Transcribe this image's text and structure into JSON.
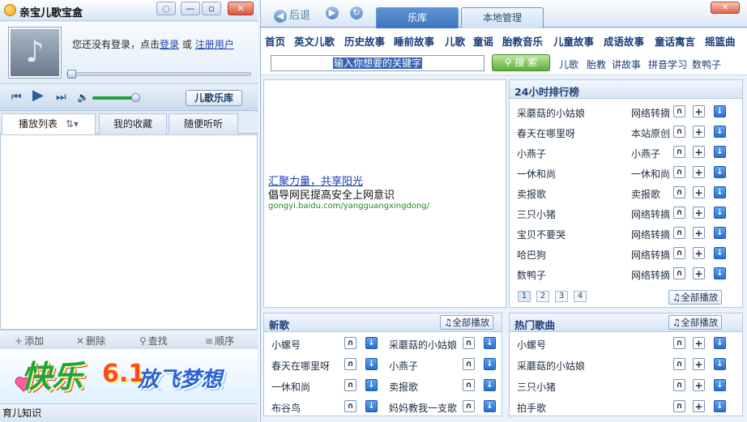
{
  "left": {
    "title": "亲宝儿歌宝盒",
    "login": {
      "prefix": "您还没有登录，点击",
      "login_link": "登录",
      "middle": "或",
      "register_link": "注册用户"
    },
    "songlib_button": "儿歌乐库",
    "tabs": [
      "播放列表",
      "我的收藏",
      "随便听听"
    ],
    "tools": [
      "添加",
      "删除",
      "查找",
      "顺序"
    ],
    "banner": {
      "a": "快乐",
      "b": "6.1",
      "c": "放飞梦想"
    },
    "status": "育儿知识"
  },
  "right": {
    "nav": {
      "back": "后退"
    },
    "tabs": [
      "乐库",
      "本地管理"
    ],
    "categories": [
      "首页",
      "英文儿歌",
      "历史故事",
      "睡前故事",
      "儿歌",
      "童谣",
      "胎教音乐",
      "儿童故事",
      "成语故事",
      "童话寓言",
      "摇篮曲"
    ],
    "search": {
      "placeholder": "输入你想要的关键字",
      "button": "搜 索"
    },
    "quick_links": [
      "儿歌",
      "胎教",
      "讲故事",
      "拼音学习",
      "数鸭子"
    ],
    "ad": {
      "link": "汇聚力量，共享阳光",
      "text": "倡导网民提高安全上网意识",
      "url": "gongyi.baidu.com/yangguangxingdong/"
    },
    "rank": {
      "title": "24小时排行榜",
      "rows": [
        {
          "song": "采蘑菇的小姑娘",
          "source": "网络转摘"
        },
        {
          "song": "春天在哪里呀",
          "source": "本站原创"
        },
        {
          "song": "小燕子",
          "source": "小燕子"
        },
        {
          "song": "一休和尚",
          "source": "一休和尚"
        },
        {
          "song": "卖报歌",
          "source": "卖报歌"
        },
        {
          "song": "三只小猪",
          "source": "网络转摘"
        },
        {
          "song": "宝贝不要哭",
          "source": "网络转摘"
        },
        {
          "song": "哈巴狗",
          "source": "网络转摘"
        },
        {
          "song": "数鸭子",
          "source": "网络转摘"
        }
      ],
      "pages": [
        "1",
        "2",
        "3",
        "4"
      ],
      "play_all": "全部播放"
    },
    "new_songs": {
      "title": "新歌",
      "play_all": "全部播放",
      "rows": [
        [
          "小螺号",
          "采蘑菇的小姑娘"
        ],
        [
          "春天在哪里呀",
          "小燕子"
        ],
        [
          "一休和尚",
          "卖报歌"
        ],
        [
          "布谷鸟",
          "妈妈教我一支歌"
        ]
      ]
    },
    "hot_songs": {
      "title": "热门歌曲",
      "play_all": "全部播放",
      "rows": [
        "小螺号",
        "采蘑菇的小姑娘",
        "三只小猪",
        "拍手歌"
      ]
    }
  }
}
